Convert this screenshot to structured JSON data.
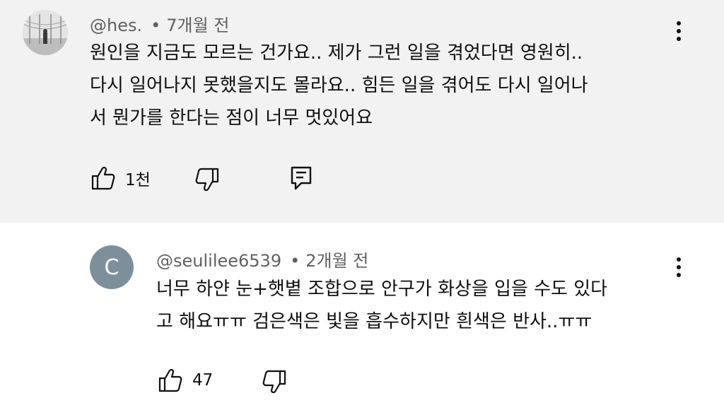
{
  "comments": [
    {
      "author": "@hes.",
      "separator": "•",
      "time": "7개월 전",
      "lines": [
        "원인을 지금도 모르는 건가요.. 제가 그런 일을 겪었다면 영원히..",
        "다시 일어나지 못했을지도 몰라요.. 힘든 일을 겪어도 다시 일어나",
        "서 뭔가를 한다는 점이 너무 멋있어요"
      ],
      "like_count": "1천",
      "icons": {
        "like": "thumbs-up-icon",
        "dislike": "thumbs-down-icon",
        "reply": "comment-icon",
        "more": "more-vert-icon"
      }
    },
    {
      "author": "@seulilee6539",
      "separator": "•",
      "time": "2개월 전",
      "avatar_letter": "C",
      "avatar_color": "#7e8f9c",
      "lines": [
        "너무 하얀 눈+햇볕 조합으로 안구가 화상을 입을 수도 있다",
        "고 해요ㅠㅠ 검은색은 빛을 흡수하지만 흰색은 반사..ㅠㅠ"
      ],
      "like_count": "47",
      "icons": {
        "like": "thumbs-up-icon",
        "dislike": "thumbs-down-icon",
        "more": "more-vert-icon"
      }
    }
  ],
  "colors": {
    "top_bg": "#f2f2f2",
    "reply_bg": "#ffffff",
    "meta_text": "#606060",
    "body_text": "#0f0f0f"
  }
}
